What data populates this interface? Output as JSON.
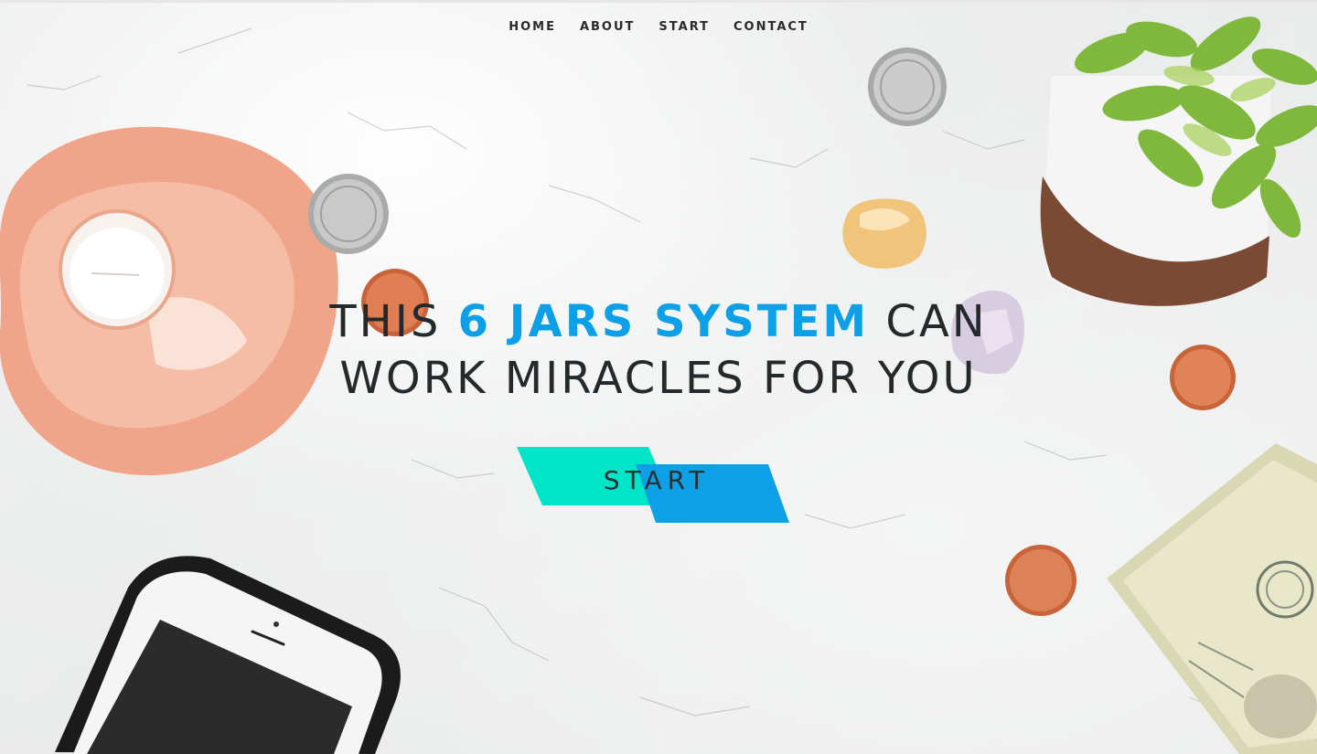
{
  "nav": {
    "items": [
      {
        "label": "HOME"
      },
      {
        "label": "ABOUT"
      },
      {
        "label": "START"
      },
      {
        "label": "CONTACT"
      }
    ]
  },
  "hero": {
    "headline_prefix": "THIS ",
    "headline_accent": "6 JARS SYSTEM",
    "headline_suffix": " CAN",
    "headline_line2": "WORK MIRACLES FOR YOU",
    "cta_label": "START"
  },
  "colors": {
    "accent_blue": "#0ea0e6",
    "accent_teal": "#00e5c7",
    "text_dark": "#24292c"
  }
}
